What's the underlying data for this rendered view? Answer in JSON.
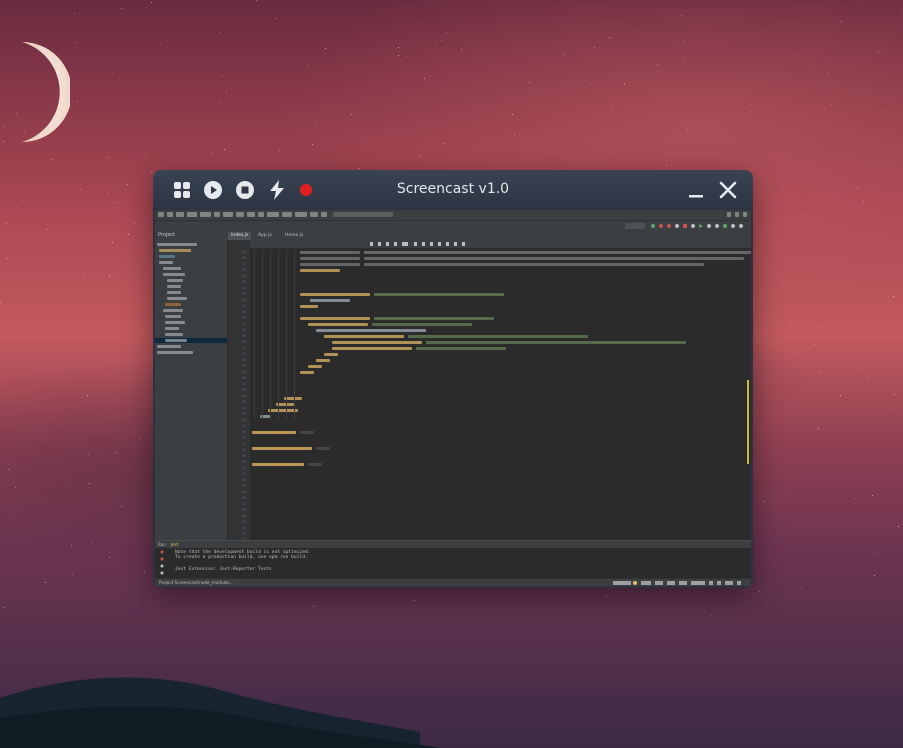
{
  "window": {
    "title": "Screencast v1.0",
    "toolbar": [
      "apps-icon",
      "play-icon",
      "stop-icon",
      "flash-icon",
      "record-icon"
    ],
    "record_color": "#e0201f"
  },
  "ide": {
    "project_label": "Project",
    "tabs": [
      "index.js",
      "App.js",
      "Home.js"
    ],
    "bottom_tabs": [
      "Run",
      "Jest"
    ],
    "terminal_lines": [
      "Note that the development build is not optimized.",
      "To create a production build, use npm run build.",
      "",
      "Jest Extension: Jest-Reporter Tests"
    ],
    "status_left": "Project Screencast/node_modules..."
  }
}
